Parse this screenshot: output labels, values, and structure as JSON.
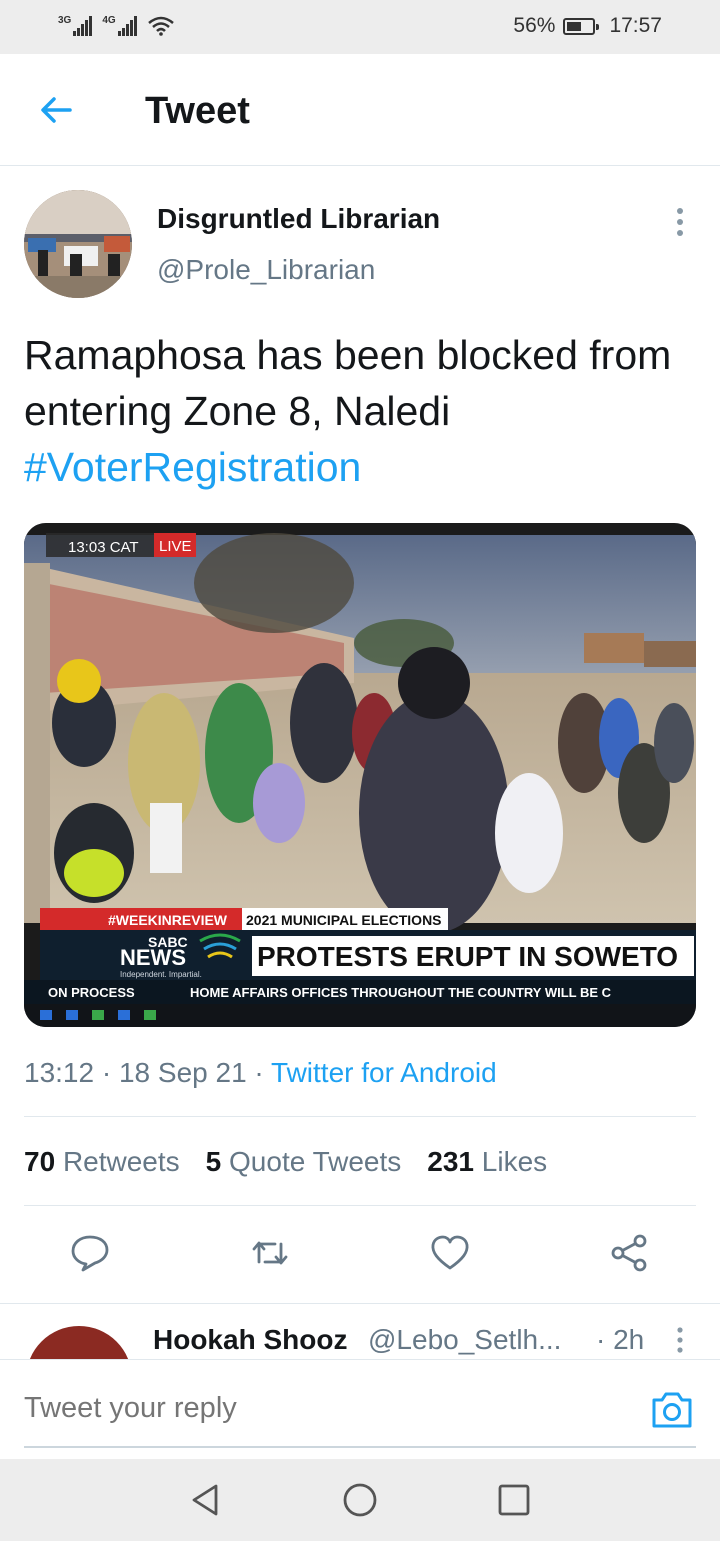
{
  "status_bar": {
    "network1": "3G",
    "network2": "4G",
    "battery_percent": "56%",
    "time": "17:57"
  },
  "header": {
    "title": "Tweet"
  },
  "tweet": {
    "author_name": "Disgruntled Librarian",
    "author_handle": "@Prole_Librarian",
    "text": "Ramaphosa has been blocked from entering Zone 8, Naledi",
    "hashtag": "#VoterRegistration",
    "time": "13:12",
    "date": "18 Sep 21",
    "source": "Twitter for Android"
  },
  "media": {
    "timestamp": "13:03 CAT",
    "live": "LIVE",
    "tag1": "#WEEKINREVIEW",
    "tag2": "2021 MUNICIPAL ELECTIONS",
    "brand_top": "SABC",
    "brand_bottom": "NEWS",
    "brand_tagline": "Independent. Impartial.",
    "headline": "PROTESTS ERUPT IN SOWETO",
    "ticker_left": "ON PROCESS",
    "ticker": "HOME AFFAIRS OFFICES THROUGHOUT THE COUNTRY WILL BE C"
  },
  "stats": {
    "retweets_count": "70",
    "retweets_label": "Retweets",
    "quotes_count": "5",
    "quotes_label": "Quote Tweets",
    "likes_count": "231",
    "likes_label": "Likes"
  },
  "reply_preview": {
    "name": "Hookah Shooz",
    "handle": "@Lebo_Setlh...",
    "time": "· 2h"
  },
  "reply_bar": {
    "placeholder": "Tweet your reply"
  },
  "colors": {
    "accent": "#1da1f2",
    "text": "#14171a",
    "secondary": "#657786",
    "live_red": "#d42a2a"
  },
  "icons": {
    "back": "arrow-left-icon",
    "more": "vertical-dots-icon",
    "reply": "comment-icon",
    "retweet": "retweet-icon",
    "like": "heart-icon",
    "share": "share-icon",
    "camera": "camera-icon"
  }
}
